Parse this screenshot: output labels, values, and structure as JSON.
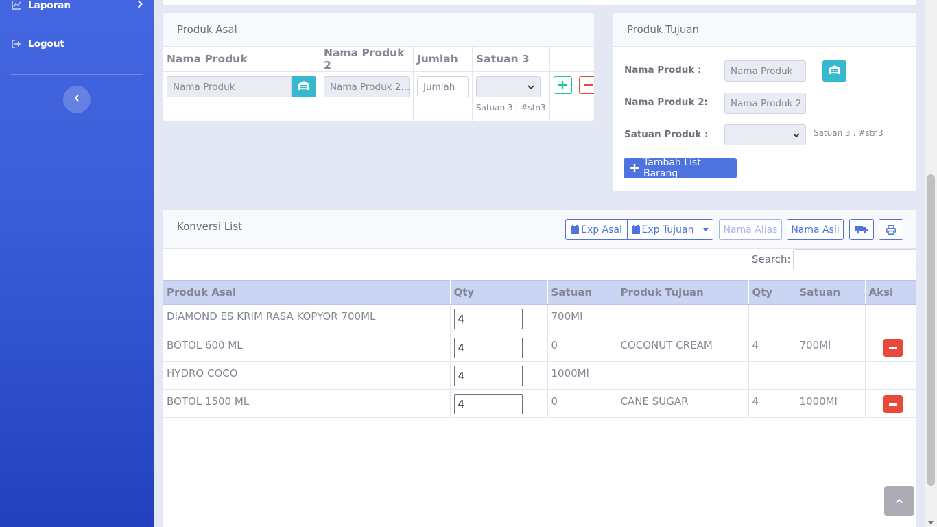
{
  "sidebar": {
    "laporan": "Laporan",
    "logout": "Logout"
  },
  "produk_asal": {
    "title": "Produk Asal",
    "columns": [
      "Nama Produk",
      "Nama Produk 2",
      "Jumlah",
      "Satuan 3"
    ],
    "nama_produk_placeholder": "Nama Produk",
    "nama_produk2_placeholder": "Nama Produk 2...",
    "jumlah_placeholder": "Jumlah",
    "satuan_note": "Satuan 3 : #stn3"
  },
  "produk_tujuan": {
    "title": "Produk Tujuan",
    "label_nama": "Nama Produk :",
    "label_nama2": "Nama Produk 2:",
    "label_satuan": "Satuan Produk :",
    "nama_placeholder": "Nama Produk",
    "nama2_placeholder": "Nama Produk 2...",
    "satuan_note": "Satuan 3 : #stn3",
    "add_button": "Tambah List Barang"
  },
  "konversi": {
    "title": "Konversi List",
    "buttons": {
      "exp_asal": "Exp Asal",
      "exp_tujuan": "Exp Tujuan",
      "nama_alias": "Nama Alias",
      "nama_asli": "Nama Asli"
    },
    "search_label": "Search:",
    "headers": [
      "Produk Asal",
      "Qty",
      "Satuan",
      "Produk Tujuan",
      "Qty",
      "Satuan",
      "Aksi"
    ],
    "rows": [
      {
        "asal": "DIAMOND ES KRIM RASA KOPYOR 700ML",
        "qty": "4",
        "satuan": "700Ml",
        "tujuan": "",
        "qty2": "",
        "satuan2": "",
        "delete": false
      },
      {
        "asal": "BOTOL 600 ML",
        "qty": "4",
        "satuan": "0",
        "tujuan": "COCONUT CREAM",
        "qty2": "4",
        "satuan2": "700Ml",
        "delete": true
      },
      {
        "asal": "HYDRO COCO",
        "qty": "4",
        "satuan": "1000Ml",
        "tujuan": "",
        "qty2": "",
        "satuan2": "",
        "delete": false
      },
      {
        "asal": "BOTOL 1500 ML",
        "qty": "4",
        "satuan": "0",
        "tujuan": "CANE SUGAR",
        "qty2": "4",
        "satuan2": "1000Ml",
        "delete": true
      }
    ]
  },
  "colors": {
    "primary": "#4e73df",
    "info": "#36b9cc",
    "success": "#1cc88a",
    "danger": "#e74a3b",
    "table_header": "#cad5f3"
  },
  "icons": [
    "chart-icon",
    "chevron-right-icon",
    "sign-out-icon",
    "chevron-left-icon",
    "warehouse-icon",
    "plus-icon",
    "minus-icon",
    "calendar-icon",
    "caret-down-icon",
    "truck-icon",
    "print-icon",
    "chevron-up-icon"
  ]
}
